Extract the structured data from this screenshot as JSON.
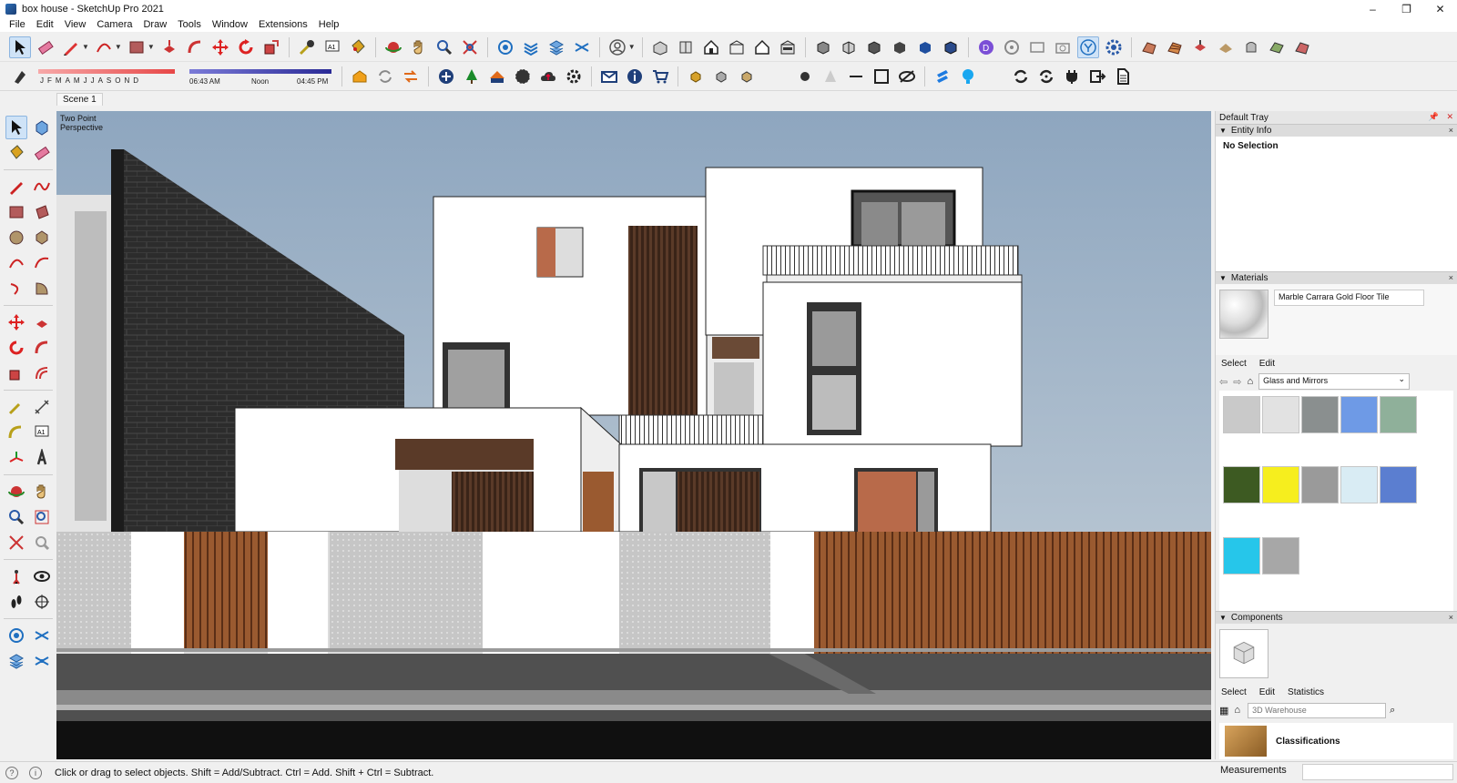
{
  "window": {
    "title": "box house - SketchUp Pro 2021",
    "buttons": [
      "–",
      "❐",
      "✕"
    ]
  },
  "menu": [
    "File",
    "Edit",
    "View",
    "Camera",
    "Draw",
    "Tools",
    "Window",
    "Extensions",
    "Help"
  ],
  "shadow": {
    "months": [
      "J",
      "F",
      "M",
      "A",
      "M",
      "J",
      "J",
      "A",
      "S",
      "O",
      "N",
      "D"
    ],
    "time_start": "06:43 AM",
    "time_mid": "Noon",
    "time_end": "04:45 PM"
  },
  "scene": {
    "tab": "Scene 1",
    "camera_line1": "Two Point",
    "camera_line2": "Perspective"
  },
  "tray": {
    "title": "Default Tray",
    "entity_info": {
      "header": "Entity Info",
      "text": "No Selection"
    },
    "materials": {
      "header": "Materials",
      "current": "Marble Carrara Gold Floor Tile",
      "tab_select": "Select",
      "tab_edit": "Edit",
      "library": "Glass and Mirrors",
      "swatches": [
        "#c9c9c9",
        "#e2e2e2",
        "#8a8f8f",
        "#6e9ae6",
        "#8fb09a",
        "#3d5a22",
        "#f6ee1e",
        "#9a9a9a",
        "#d9ecf4",
        "#5b7ed0",
        "#26c6ea",
        "#a7a7a7"
      ]
    },
    "components": {
      "header": "Components",
      "tab_select": "Select",
      "tab_edit": "Edit",
      "tab_stats": "Statistics",
      "search_placeholder": "3D Warehouse",
      "classifications": "Classifications"
    }
  },
  "status": {
    "message": "Click or drag to select objects. Shift = Add/Subtract. Ctrl = Add. Shift + Ctrl = Subtract.",
    "measurements_label": "Measurements",
    "measurements_value": ""
  },
  "colors": {
    "accent_red": "#d32626",
    "accent_blue": "#1e6fd0"
  }
}
